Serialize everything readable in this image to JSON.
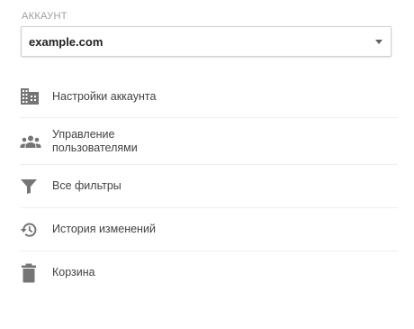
{
  "account_section": {
    "label": "АККАУНТ",
    "selected_account": "example.com"
  },
  "menu": {
    "items": [
      {
        "label": "Настройки аккаунта",
        "icon": "building-icon"
      },
      {
        "label": "Управление пользователями",
        "icon": "people-icon"
      },
      {
        "label": "Все фильтры",
        "icon": "filter-icon"
      },
      {
        "label": "История изменений",
        "icon": "history-icon"
      },
      {
        "label": "Корзина",
        "icon": "trash-icon"
      }
    ]
  },
  "colors": {
    "icon": "#757575",
    "text": "#424242",
    "label_muted": "#9e9e9e",
    "divider": "#eeeeee"
  }
}
